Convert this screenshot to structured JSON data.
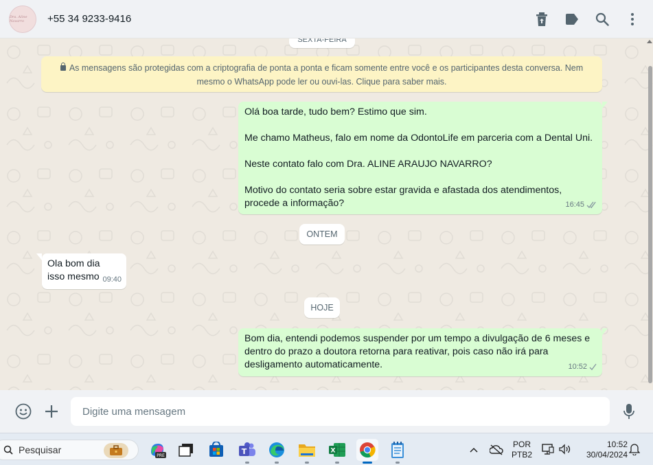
{
  "header": {
    "avatar_text": "Dra. Aline Navarro",
    "contact": "+55 34 9233-9416",
    "icons": [
      "archive-icon",
      "label-icon",
      "search-icon",
      "more-icon"
    ]
  },
  "chat": {
    "top_date_chip": "SEXTA-FEIRA",
    "encryption_notice": "As mensagens são protegidas com a criptografia de ponta a ponta e ficam somente entre você e os participantes desta conversa. Nem mesmo o WhatsApp pode ler ou ouvi-las. Clique para saber mais.",
    "messages": [
      {
        "direction": "out",
        "text": "Olá boa tarde, tudo bem? Estimo que sim.\n\nMe chamo Matheus, falo em nome da OdontoLife em parceria com a Dental Uni.\n\nNeste contato falo com Dra. ALINE ARAUJO NAVARRO?\n\nMotivo do contato seria sobre estar gravida e afastada dos atendimentos, procede a informação?",
        "time": "16:45",
        "status": "read"
      },
      {
        "type": "date",
        "label": "ONTEM"
      },
      {
        "direction": "in",
        "text": "Ola bom dia\nisso mesmo",
        "time": "09:40"
      },
      {
        "type": "date",
        "label": "HOJE"
      },
      {
        "direction": "out",
        "text": "Bom dia, entendi podemos suspender por um tempo a divulgação de 6 meses e dentro do prazo a doutora retorna para reativar, pois caso não irá para desligamento automaticamente.",
        "time": "10:52",
        "status": "sent"
      }
    ]
  },
  "composer": {
    "placeholder": "Digite uma mensagem"
  },
  "taskbar": {
    "search_label": "Pesquisar",
    "lang_line1": "POR",
    "lang_line2": "PTB2",
    "time": "10:52",
    "date": "30/04/2024"
  },
  "colors": {
    "outgoing_bubble": "#d9fdd3",
    "incoming_bubble": "#ffffff",
    "chat_background": "#efeae2",
    "encryption_bg": "#fdf4c5",
    "read_check": "#53bdeb"
  }
}
